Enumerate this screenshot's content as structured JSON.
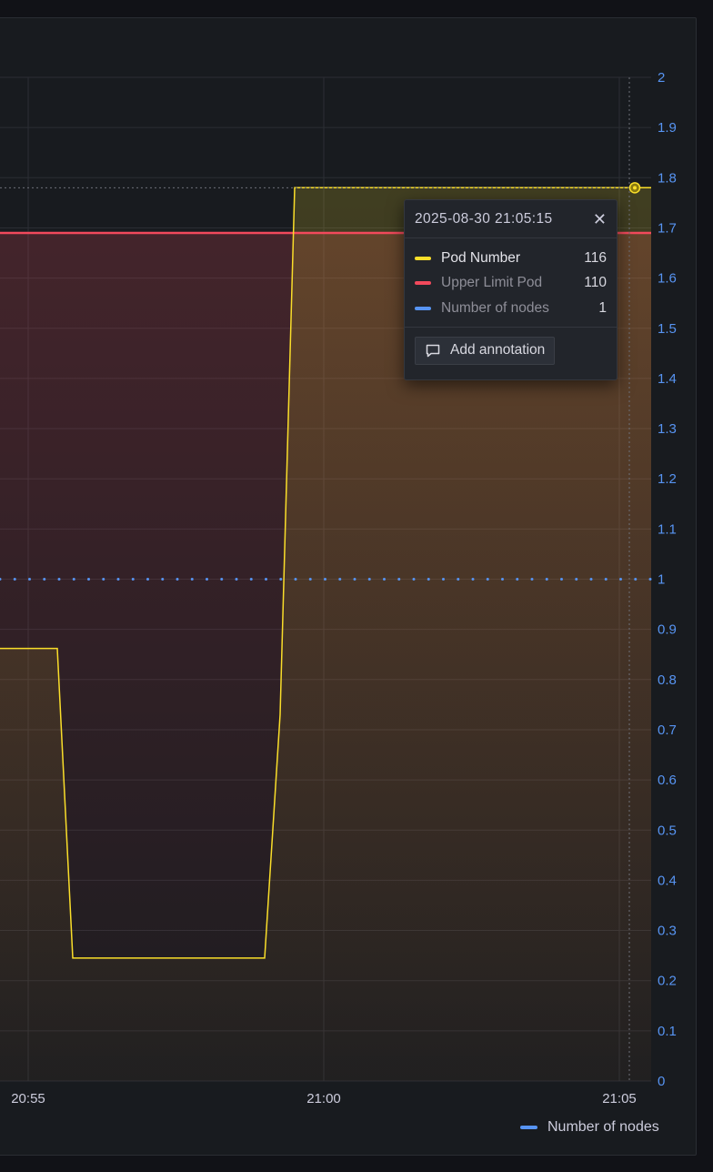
{
  "chart_data": {
    "type": "line",
    "y_ticks": [
      "0",
      "0.1",
      "0.2",
      "0.3",
      "0.4",
      "0.5",
      "0.6",
      "0.7",
      "0.8",
      "0.9",
      "1",
      "1.1",
      "1.2",
      "1.3",
      "1.4",
      "1.5",
      "1.6",
      "1.7",
      "1.8",
      "1.9",
      "2"
    ],
    "ylim": [
      0,
      2
    ],
    "y_axis_side": "right",
    "x_ticks": [
      "20:55",
      "21:00",
      "21:05"
    ],
    "grid": true,
    "series": [
      {
        "name": "Pod Number",
        "color": "#fade2a",
        "style": "solid",
        "fill": "gradient",
        "points": [
          [
            0,
            0.862
          ],
          [
            63,
            0.862
          ],
          [
            80,
            0.245
          ],
          [
            291,
            0.245
          ],
          [
            308,
            0.73
          ],
          [
            324,
            1.78
          ],
          [
            716,
            1.78
          ]
        ]
      },
      {
        "name": "Upper Limit Pod",
        "color": "#f2495c",
        "style": "solid",
        "fill": "gradient",
        "points": [
          [
            0,
            1.69
          ],
          [
            716,
            1.69
          ]
        ]
      },
      {
        "name": "Number of nodes",
        "color": "#5794f2",
        "style": "dotted",
        "points": [
          [
            0,
            1
          ],
          [
            716,
            1
          ]
        ]
      }
    ],
    "legend": {
      "placement": "bottom-right",
      "items": [
        "Number of nodes"
      ]
    }
  },
  "tooltip": {
    "time": "2025-08-30 21:05:15",
    "close_icon": "close-icon",
    "rows": [
      {
        "name": "Pod Number",
        "value": "116",
        "color": "#fade2a"
      },
      {
        "name": "Upper Limit Pod",
        "value": "110",
        "color": "#f2495c"
      },
      {
        "name": "Number of nodes",
        "value": "1",
        "color": "#5794f2"
      }
    ],
    "annotation_button": "Add annotation",
    "annotation_icon": "comment-icon"
  },
  "legend_items": [
    {
      "label": "Number of nodes",
      "color": "#5794f2"
    }
  ]
}
